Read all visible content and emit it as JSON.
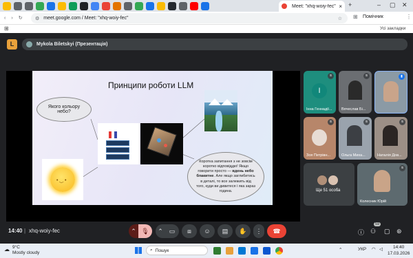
{
  "browser": {
    "active_tab_title": "Meet: \"xhq-woiy-fec\"",
    "url": "meet.google.com / Meet: \"xhq-woiy-fec\"",
    "profile_label": "Помічник",
    "bookmarks_label": "Усі закладки"
  },
  "meet": {
    "presenter_label": "Mykola Biletskyi (Презентація)",
    "meeting_time": "14:40",
    "meeting_code": "xhq-woiy-fec",
    "participants_badge": "59",
    "more_count_label": "Ще 51 особа"
  },
  "slide": {
    "title": "Принципи роботи LLM",
    "question": "Якого кольору небо?",
    "answer_pre": "Коротка запитання з не зовсім коротко відповіддю! Якщо говорити просто —",
    "answer_bold": "вдень небо блакитне",
    "answer_post": ". Але якщо заглибитись в деталі, то все залежить від того, куди ви дивитеся і яка зараз година."
  },
  "tiles": [
    {
      "name": "Інна Геннадії...",
      "initial": "I",
      "color": "#1e8e7e"
    },
    {
      "name": "Вячеслав Бі...",
      "color": "#6b6e72"
    },
    {
      "name": "",
      "color": "#8b9aa5"
    },
    {
      "name": "Зоя Петрівн...",
      "color": "#b7866a"
    },
    {
      "name": "Ольга Михa...",
      "color": "#9aa3ad"
    },
    {
      "name": "Наталія Дов...",
      "color": "#9c8f86"
    },
    {
      "name": "Ще 51 особа",
      "color": "#3c4043"
    },
    {
      "name": "Колесник Юрій",
      "color": "#5d6a6f"
    }
  ],
  "taskbar": {
    "temperature": "9°C",
    "weather": "Mostly cloudy",
    "search_label": "Пошук",
    "language": "УКР",
    "clock_time": "14:40",
    "clock_date": "17.03.2026"
  }
}
